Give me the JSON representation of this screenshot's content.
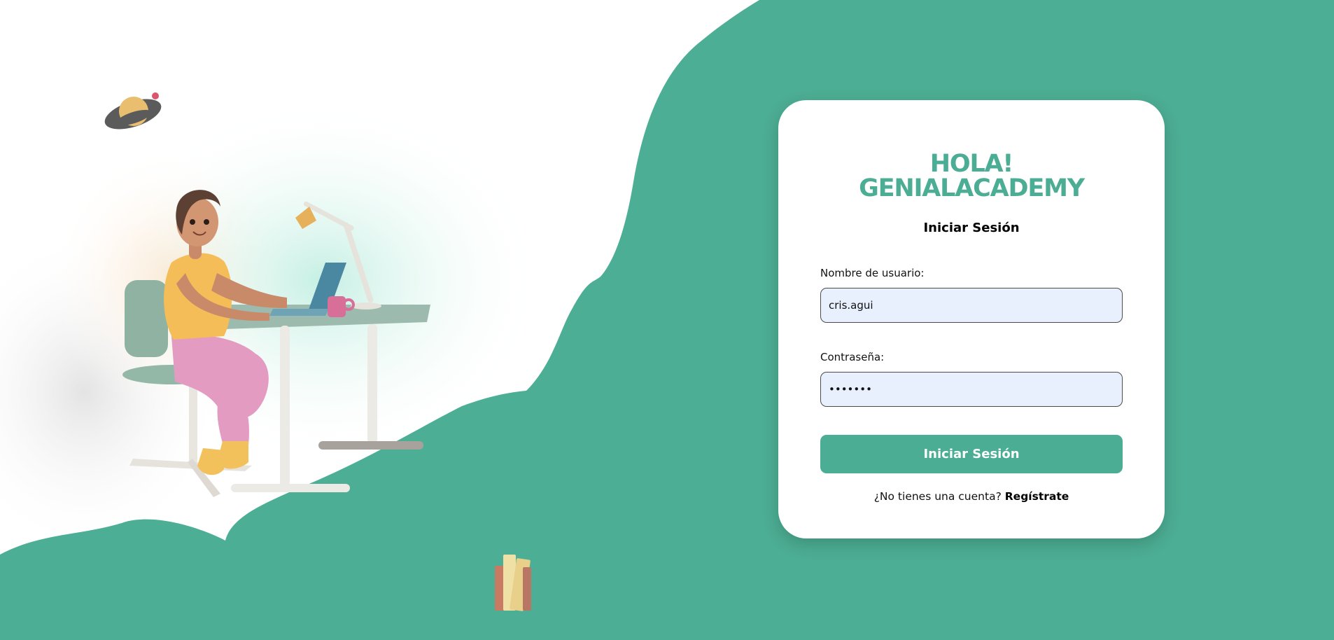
{
  "colors": {
    "brand_green": "#4aad94",
    "input_background": "#e8f0fe",
    "background": "#ffffff"
  },
  "illustrations": {
    "planet": "planet-icon",
    "student": "student-at-desk-illustration",
    "books": "books-icon"
  },
  "login": {
    "title": "HOLA! GENIALACADEMY",
    "subtitle": "Iniciar Sesión",
    "username_label": "Nombre de usuario:",
    "username_value": "cris.agui",
    "password_label": "Contraseña:",
    "password_value": "•••••••",
    "submit_label": "Iniciar Sesión",
    "no_account_text": "¿No tienes una cuenta?",
    "register_link": "Regístrate"
  }
}
